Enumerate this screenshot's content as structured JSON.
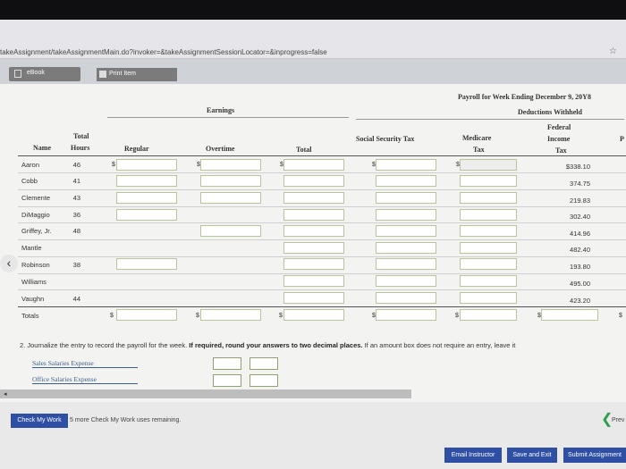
{
  "browser": {
    "url": "takeAssignment/takeAssignmentMain.do?invoker=&takeAssignmentSessionLocator=&inprogress=false"
  },
  "toolbar": {
    "ebook_label": "eBook",
    "print_label": "Print Item"
  },
  "headers": {
    "payroll_title": "Payroll for Week Ending December 9, 20Y8",
    "earnings": "Earnings",
    "deductions": "Deductions Withheld",
    "name": "Name",
    "total_hours_1": "Total",
    "total_hours_2": "Hours",
    "regular": "Regular",
    "overtime": "Overtime",
    "total": "Total",
    "social_security": "Social Security Tax",
    "medicare_1": "Medicare",
    "medicare_2": "Tax",
    "federal_1": "Federal",
    "federal_2": "Income",
    "federal_3": "Tax",
    "extra_col": "P"
  },
  "rows": [
    {
      "name": "Aaron",
      "hours": "46",
      "fed": "$338.10"
    },
    {
      "name": "Cobb",
      "hours": "41",
      "fed": "374.75"
    },
    {
      "name": "Clemente",
      "hours": "43",
      "fed": "219.83"
    },
    {
      "name": "DiMaggio",
      "hours": "36",
      "fed": "302.40"
    },
    {
      "name": "Griffey, Jr.",
      "hours": "48",
      "fed": "414.96"
    },
    {
      "name": "Mantle",
      "hours": "",
      "fed": "482.40"
    },
    {
      "name": "Robinson",
      "hours": "38",
      "fed": "193.80"
    },
    {
      "name": "Williams",
      "hours": "",
      "fed": "495.00"
    },
    {
      "name": "Vaughn",
      "hours": "44",
      "fed": "423.20"
    }
  ],
  "totals_label": "Totals",
  "dollar_sign": "$",
  "question2": {
    "prefix": "2. Journalize the entry to record the payroll for the week.",
    "bold": "If required, round your answers to two decimal places.",
    "suffix": "If an amount box does not require an entry, leave it"
  },
  "accounts": [
    "Sales Salaries Expense",
    "Office Salaries Expense"
  ],
  "footer": {
    "check_btn": "Check My Work",
    "check_note": "5 more Check My Work uses remaining.",
    "prev": "Prev",
    "email": "Email Instructor",
    "save": "Save and Exit",
    "submit": "Submit Assignment"
  }
}
